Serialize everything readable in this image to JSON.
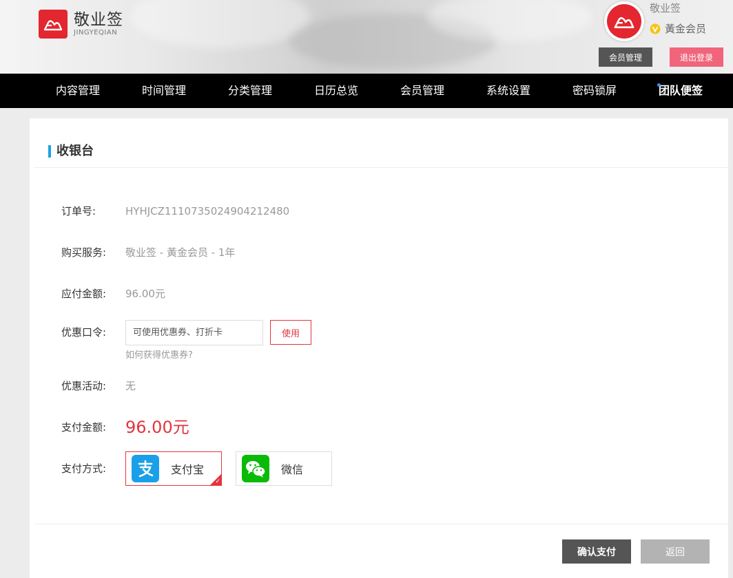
{
  "brand": {
    "name_cn": "敬业签",
    "name_en": "JINGYEQIAN"
  },
  "user": {
    "name": "敬业签",
    "level": "黃金会员"
  },
  "header_buttons": {
    "member_manage": "会员管理",
    "logout": "退出登录"
  },
  "nav": {
    "items": [
      {
        "label": "内容管理"
      },
      {
        "label": "时间管理"
      },
      {
        "label": "分类管理"
      },
      {
        "label": "日历总览"
      },
      {
        "label": "会员管理"
      },
      {
        "label": "系统设置"
      },
      {
        "label": "密码锁屏"
      },
      {
        "label": "团队便签"
      }
    ],
    "active_index": 7
  },
  "checkout": {
    "title": "收银台",
    "order_no_label": "订单号:",
    "order_no": "HYHJCZ1110735024904212480",
    "service_label": "购买服务:",
    "service": "敬业签 - 黃金会员 - 1年",
    "payable_label": "应付金额:",
    "payable": "96.00元",
    "coupon_label": "优惠口令:",
    "coupon_placeholder": "可使用优惠券、打折卡",
    "coupon_button": "使用",
    "coupon_help": "如何获得优惠券?",
    "promo_label": "优惠活动:",
    "promo": "无",
    "pay_amount_label": "支付金额:",
    "pay_amount": "96.00元",
    "pay_method_label": "支付方式:",
    "methods": [
      {
        "label": "支付宝",
        "icon": "alipay-icon",
        "color": "#1aa0e8",
        "selected": true
      },
      {
        "label": "微信",
        "icon": "wechat-icon",
        "color": "#09bb07",
        "selected": false
      }
    ],
    "confirm_button": "确认支付",
    "back_button": "返回"
  },
  "colors": {
    "brand_red": "#e3262f",
    "accent_blue": "#1aa3e6",
    "logout_pink": "#f0657c",
    "nav_bg": "#000000"
  }
}
